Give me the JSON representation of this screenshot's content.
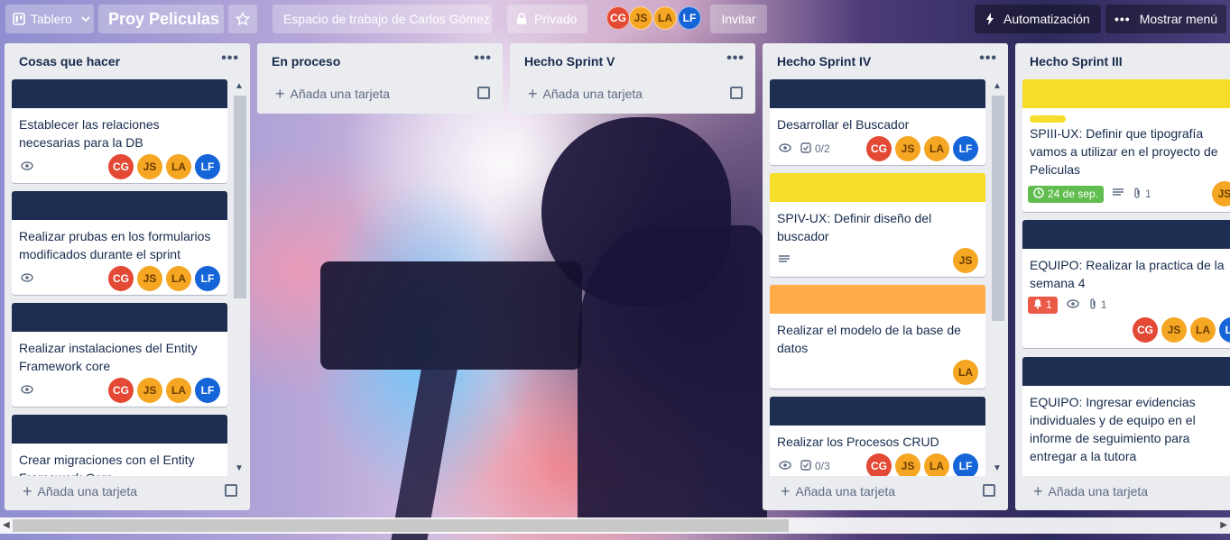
{
  "header": {
    "board_switch": "Tablero",
    "board_title": "Proy Peliculas",
    "workspace": "Espacio de trabajo de Carlos Gómez",
    "visibility": "Privado",
    "members": [
      "CG",
      "JS",
      "LA",
      "LF"
    ],
    "invite": "Invitar",
    "automation": "Automatización",
    "show_menu": "Mostrar menú"
  },
  "lists": [
    {
      "title": "Cosas que hacer",
      "add_card": "Añada una tarjeta",
      "cards": [
        {
          "title": "Establecer las relaciones necesarias para la DB",
          "members": [
            "CG",
            "JS",
            "LA",
            "LF"
          ]
        },
        {
          "title": "Realizar prubas en los formularios modificados durante el sprint",
          "members": [
            "CG",
            "JS",
            "LA",
            "LF"
          ]
        },
        {
          "title": "Realizar instalaciones del Entity Framework core",
          "members": [
            "CG",
            "JS",
            "LA",
            "LF"
          ]
        },
        {
          "title": "Crear migraciones con el Entity Framework Core"
        }
      ]
    },
    {
      "title": "En proceso",
      "add_card": "Añada una tarjeta"
    },
    {
      "title": "Hecho Sprint V",
      "add_card": "Añada una tarjeta"
    },
    {
      "title": "Hecho Sprint IV",
      "add_card": "Añada una tarjeta",
      "cards": [
        {
          "title": "Desarrollar el Buscador",
          "checklist": "0/2",
          "members": [
            "CG",
            "JS",
            "LA",
            "LF"
          ]
        },
        {
          "title": "SPIV-UX: Definir diseño del buscador",
          "members": [
            "JS"
          ]
        },
        {
          "title": "Realizar el modelo de la base de datos",
          "members": [
            "LA"
          ]
        },
        {
          "title": "Realizar los Procesos CRUD",
          "checklist": "0/3",
          "members": [
            "CG",
            "JS",
            "LA",
            "LF"
          ]
        }
      ]
    },
    {
      "title": "Hecho Sprint III",
      "add_card": "Añada una tarjeta",
      "cards": [
        {
          "title": "SPIII-UX: Definir que tipografía vamos a utilizar en el proyecto de Peliculas",
          "due": "24 de sep.",
          "attachments": "1",
          "members": [
            "JS"
          ]
        },
        {
          "title": "EQUIPO: Realizar la practica de la semana 4",
          "notifications": "1",
          "attachments": "1",
          "members": [
            "CG",
            "JS",
            "LA",
            "LF"
          ]
        },
        {
          "title": "EQUIPO: Ingresar evidencias individuales y de equipo en el informe de seguimiento para entregar a la tutora"
        }
      ]
    }
  ],
  "colors": {
    "cover_navy": "#1e2e52",
    "cover_yellow": "#f5dd29",
    "cover_orange": "#ffab4a",
    "due_green": "#61bd4f",
    "alert_red": "#eb5a46"
  }
}
